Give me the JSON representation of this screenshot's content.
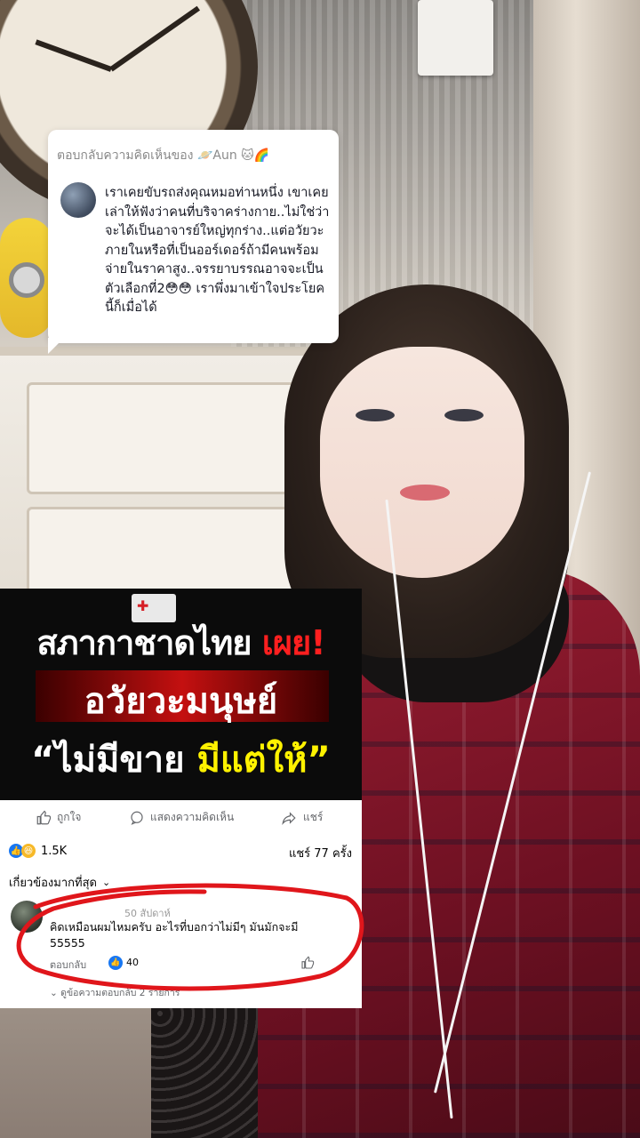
{
  "reply_sticker": {
    "header": "ตอบกลับความคิดเห็นของ 🪐Aun 🐱🌈",
    "body": "เราเคยขับรถส่งคุณหมอท่านหนึ่ง เขาเคยเล่าให้ฟังว่าคนที่บริจาคร่างกาย..ไม่ใช่ว่าจะได้เป็นอาจารย์ใหญ่ทุกร่าง..แต่อวัยวะภายในหรือที่เป็นออร์เดอร์ถ้ามีคนพร้อมจ่ายในราคาสูง..จรรยาบรรณอาจจะเป็นตัวเลือกที่2😳😳 เราพึ่งมาเข้าใจประโยคนี้ก็เมื่อได้"
  },
  "news_banner": {
    "line1_main": "สภากาชาดไทย",
    "line1_accent": "เผย!",
    "line2": "อวัยวะมนุษย์",
    "line3_main": "“ไม่มีขาย",
    "line3_accent": "มีแต่ให้”"
  },
  "fb_post": {
    "actions": {
      "like": "ถูกใจ",
      "comment": "แสดงความคิดเห็น",
      "share": "แชร์"
    },
    "reaction_count": "1.5K",
    "share_count": "แชร์ 77 ครั้ง",
    "sort_label": "เกี่ยวข้องมากที่สุด",
    "comment": {
      "meta": "50 สัปดาห์",
      "text": "คิดเหมือนผมไหมครับ อะไรที่บอกว่าไม่มีๆ มันมักจะมี 55555",
      "reply_label": "ตอบกลับ",
      "like_count": "40"
    },
    "more_replies": "ดูข้อความตอบกลับ 2 รายการ"
  },
  "colors": {
    "fb_blue": "#1877f2",
    "banner_red": "#ff1f1f",
    "banner_yellow": "#fff200",
    "ring_red": "#e0161b"
  }
}
